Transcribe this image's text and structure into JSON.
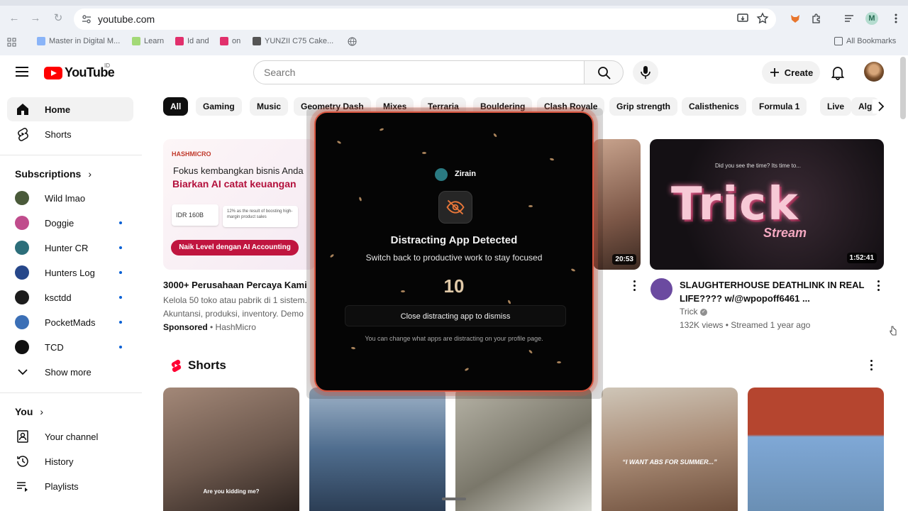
{
  "browser": {
    "url": "youtube.com",
    "bookmarks": [
      {
        "label": "Master in Digital M...",
        "color": "#8ab4f8"
      },
      {
        "label": "Learn",
        "color": "#a3d977"
      },
      {
        "label": "Id and",
        "color": "#e1306c"
      },
      {
        "label": "on",
        "color": "#e1306c"
      },
      {
        "label": "YUNZII C75 Cake...",
        "color": "#555555"
      }
    ],
    "all_bookmarks": "All Bookmarks",
    "profile_initial": "M"
  },
  "header": {
    "region": "ID",
    "logo_text": "YouTube",
    "search_placeholder": "Search",
    "create_label": "Create"
  },
  "sidebar": {
    "home": "Home",
    "shorts": "Shorts",
    "subscriptions_heading": "Subscriptions",
    "subscriptions": [
      {
        "name": "Wild lmao",
        "color": "#4a5a3a",
        "dot": false
      },
      {
        "name": "Doggie",
        "color": "#c04c8c",
        "dot": true
      },
      {
        "name": "Hunter CR",
        "color": "#2c6e7a",
        "dot": true
      },
      {
        "name": "Hunters Log",
        "color": "#26478a",
        "dot": true
      },
      {
        "name": "ksctdd",
        "color": "#1c1c1c",
        "dot": true
      },
      {
        "name": "PocketMads",
        "color": "#3b6fb6",
        "dot": true
      },
      {
        "name": "TCD",
        "color": "#111111",
        "dot": true
      }
    ],
    "show_more": "Show more",
    "you_heading": "You",
    "you_items": [
      "Your channel",
      "History",
      "Playlists"
    ]
  },
  "chips": [
    "All",
    "Gaming",
    "Music",
    "Geometry Dash",
    "Mixes",
    "Terraria",
    "Bouldering",
    "Clash Royale",
    "Grip strength",
    "Calisthenics",
    "Formula 1",
    "Live",
    "Alg"
  ],
  "ad": {
    "brand_logo": "HASHMICRO",
    "headline_1": "Fokus kembangkan bisnis Anda",
    "headline_2": "Biarkan AI catat keuangan",
    "stat_1": "IDR 160B",
    "stat_2": "12% as the result of boosting high-margin product sales",
    "cta": "Naik Level dengan AI Accounting",
    "title": "3000+ Perusahaan Percaya Kami",
    "description": "Kelola 50 toko atau pabrik di 1 sistem. Akuntansi, produksi, inventory. Demo sekarang",
    "sponsored": "Sponsored",
    "advertiser": "HashMicro"
  },
  "video_middle": {
    "duration": "20:53"
  },
  "video_right": {
    "thumbnail_text": "Trick",
    "thumbnail_sub": "Stream",
    "thumbnail_caption": "Did you see the time? Its time to...",
    "duration": "1:52:41",
    "title": "SLAUGHTERHOUSE DEATHLINK IN REAL LIFE???? w/@wpopoff6461 ...",
    "channel": "Trick",
    "stats": "132K views • Streamed 1 year ago"
  },
  "shorts_section": {
    "heading": "Shorts",
    "items": [
      {
        "caption": "Are you kidding me?",
        "color": "#7c6a5e"
      },
      {
        "caption": "",
        "color": "#5a6f8a"
      },
      {
        "caption": "",
        "color": "#8a8a7e"
      },
      {
        "caption": "“I WANT ABS FOR SUMMER...”",
        "color": "#a8907a"
      },
      {
        "caption": "",
        "color": "#6a8fb4"
      }
    ]
  },
  "overlay": {
    "app_name": "Zirain",
    "title": "Distracting App Detected",
    "subtitle": "Switch back to productive work to stay focused",
    "countdown": "10",
    "dismiss": "Close distracting app to dismiss",
    "note": "You can change what apps are distracting on your profile page."
  }
}
